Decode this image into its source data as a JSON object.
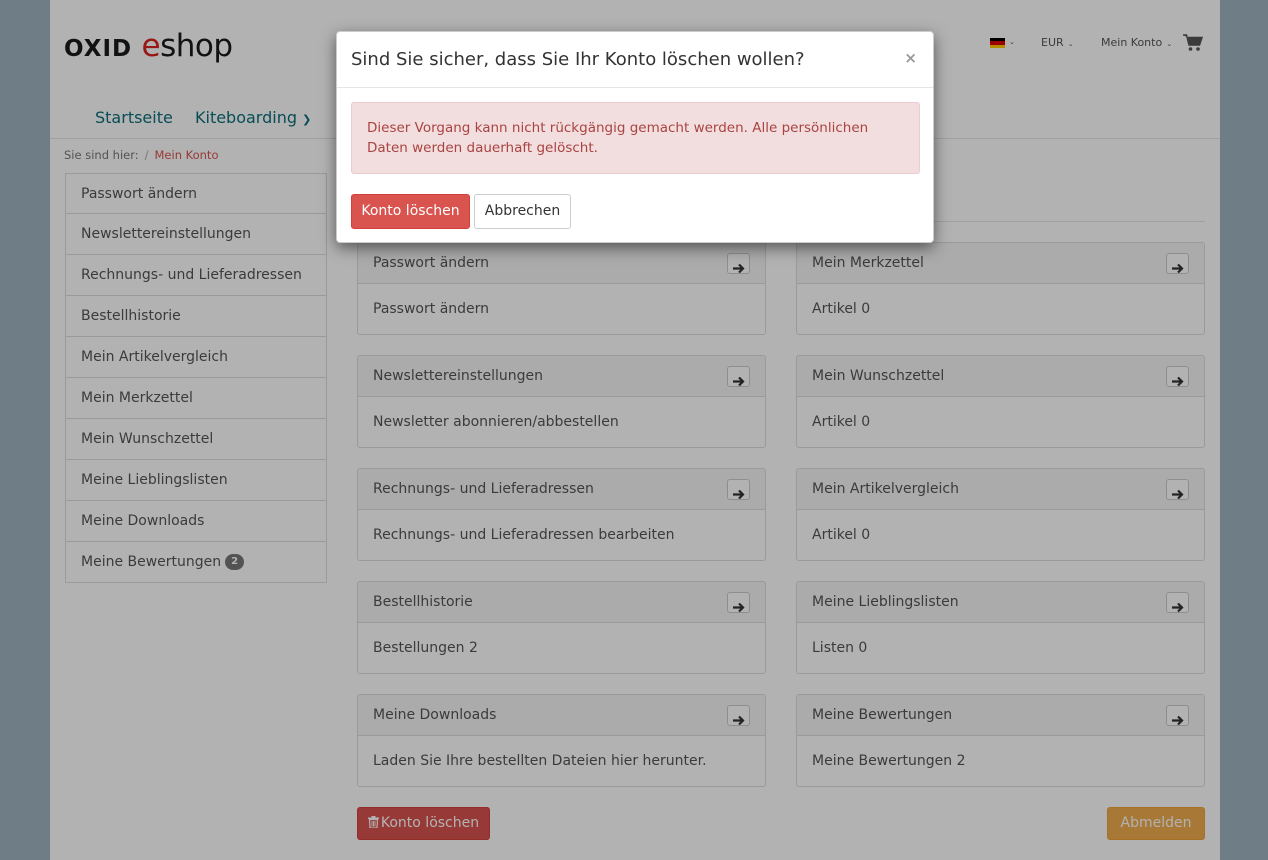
{
  "header": {
    "logo_oxid": "OXID",
    "logo_e": "e",
    "logo_shop": "shop",
    "currency": "EUR",
    "account_menu": "Mein Konto"
  },
  "nav": {
    "home": "Startseite",
    "category": "Kiteboarding"
  },
  "breadcrumb": {
    "prefix": "Sie sind hier:",
    "separator": "/",
    "current": "Mein Konto"
  },
  "sidebar": {
    "items": [
      {
        "label": "Passwort ändern"
      },
      {
        "label": "Newslettereinstellungen"
      },
      {
        "label": "Rechnungs- und Lieferadressen"
      },
      {
        "label": "Bestellhistorie"
      },
      {
        "label": "Mein Artikelvergleich"
      },
      {
        "label": "Mein Merkzettel"
      },
      {
        "label": "Mein Wunschzettel"
      },
      {
        "label": "Meine Lieblingslisten"
      },
      {
        "label": "Meine Downloads"
      },
      {
        "label": "Meine Bewertungen",
        "badge": "2"
      }
    ]
  },
  "panels": [
    {
      "title": "Passwort ändern",
      "body": "Passwort ändern"
    },
    {
      "title": "Mein Merkzettel",
      "body": "Artikel 0"
    },
    {
      "title": "Newslettereinstellungen",
      "body": "Newsletter abonnieren/abbestellen"
    },
    {
      "title": "Mein Wunschzettel",
      "body": "Artikel 0"
    },
    {
      "title": "Rechnungs- und Lieferadressen",
      "body": "Rechnungs- und Lieferadressen bearbeiten"
    },
    {
      "title": "Mein Artikelvergleich",
      "body": "Artikel 0"
    },
    {
      "title": "Bestellhistorie",
      "body": "Bestellungen 2"
    },
    {
      "title": "Meine Lieblingslisten",
      "body": "Listen 0"
    },
    {
      "title": "Meine Downloads",
      "body": "Laden Sie Ihre bestellten Dateien hier herunter."
    },
    {
      "title": "Meine Bewertungen",
      "body": "Meine Bewertungen 2"
    }
  ],
  "actions": {
    "delete_account": "Konto löschen",
    "logout": "Abmelden"
  },
  "modal": {
    "title": "Sind Sie sicher, dass Sie Ihr Konto löschen wollen?",
    "close": "×",
    "alert": "Dieser Vorgang kann nicht rückgängig gemacht werden. Alle persönlichen Daten werden dauerhaft gelöscht.",
    "confirm": "Konto löschen",
    "cancel": "Abbrechen"
  },
  "colors": {
    "danger": "#d9534f",
    "warning": "#f0ad4e",
    "nav": "#0b6f7a",
    "alert_bg": "#f2dede",
    "alert_text": "#a94442"
  }
}
